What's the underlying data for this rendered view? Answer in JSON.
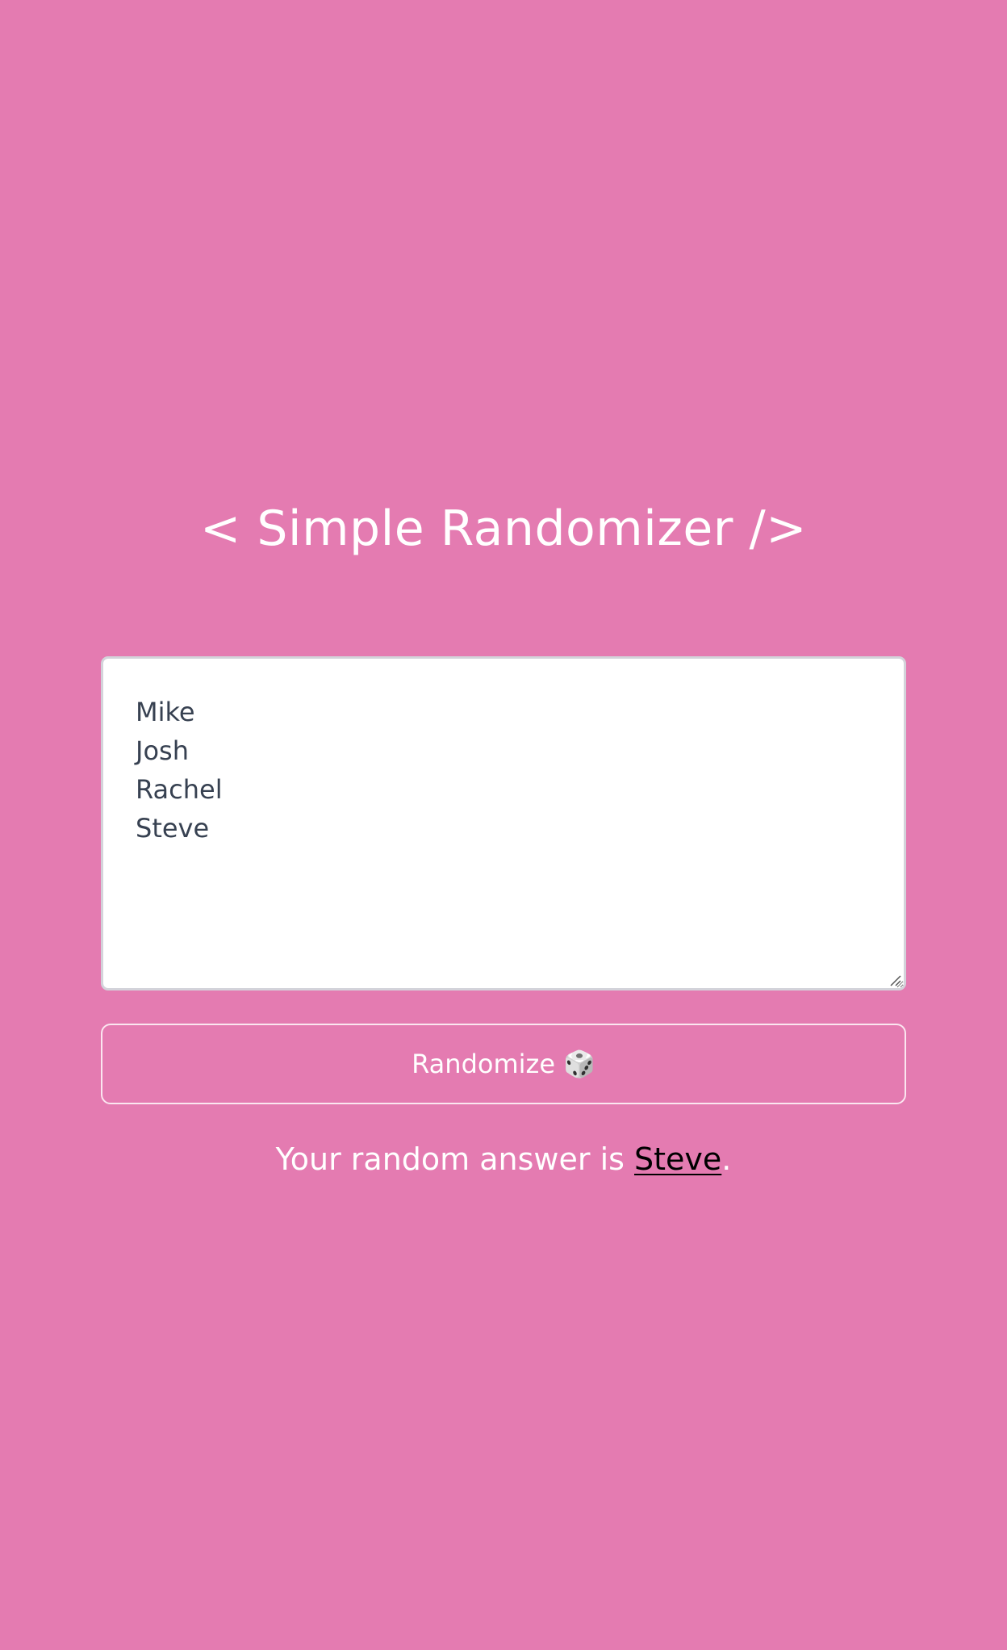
{
  "header": {
    "title": "< Simple Randomizer />"
  },
  "names_input": {
    "value": "Mike\nJosh\nRachel\nSteve"
  },
  "randomize_button": {
    "label": "Randomize",
    "icon": "🎲"
  },
  "result": {
    "prefix": "Your random answer is ",
    "answer": "Steve",
    "suffix": "."
  },
  "colors": {
    "background": "#e47bb1",
    "text": "#ffffff",
    "answer": "#000000",
    "textarea_text": "#374151"
  }
}
